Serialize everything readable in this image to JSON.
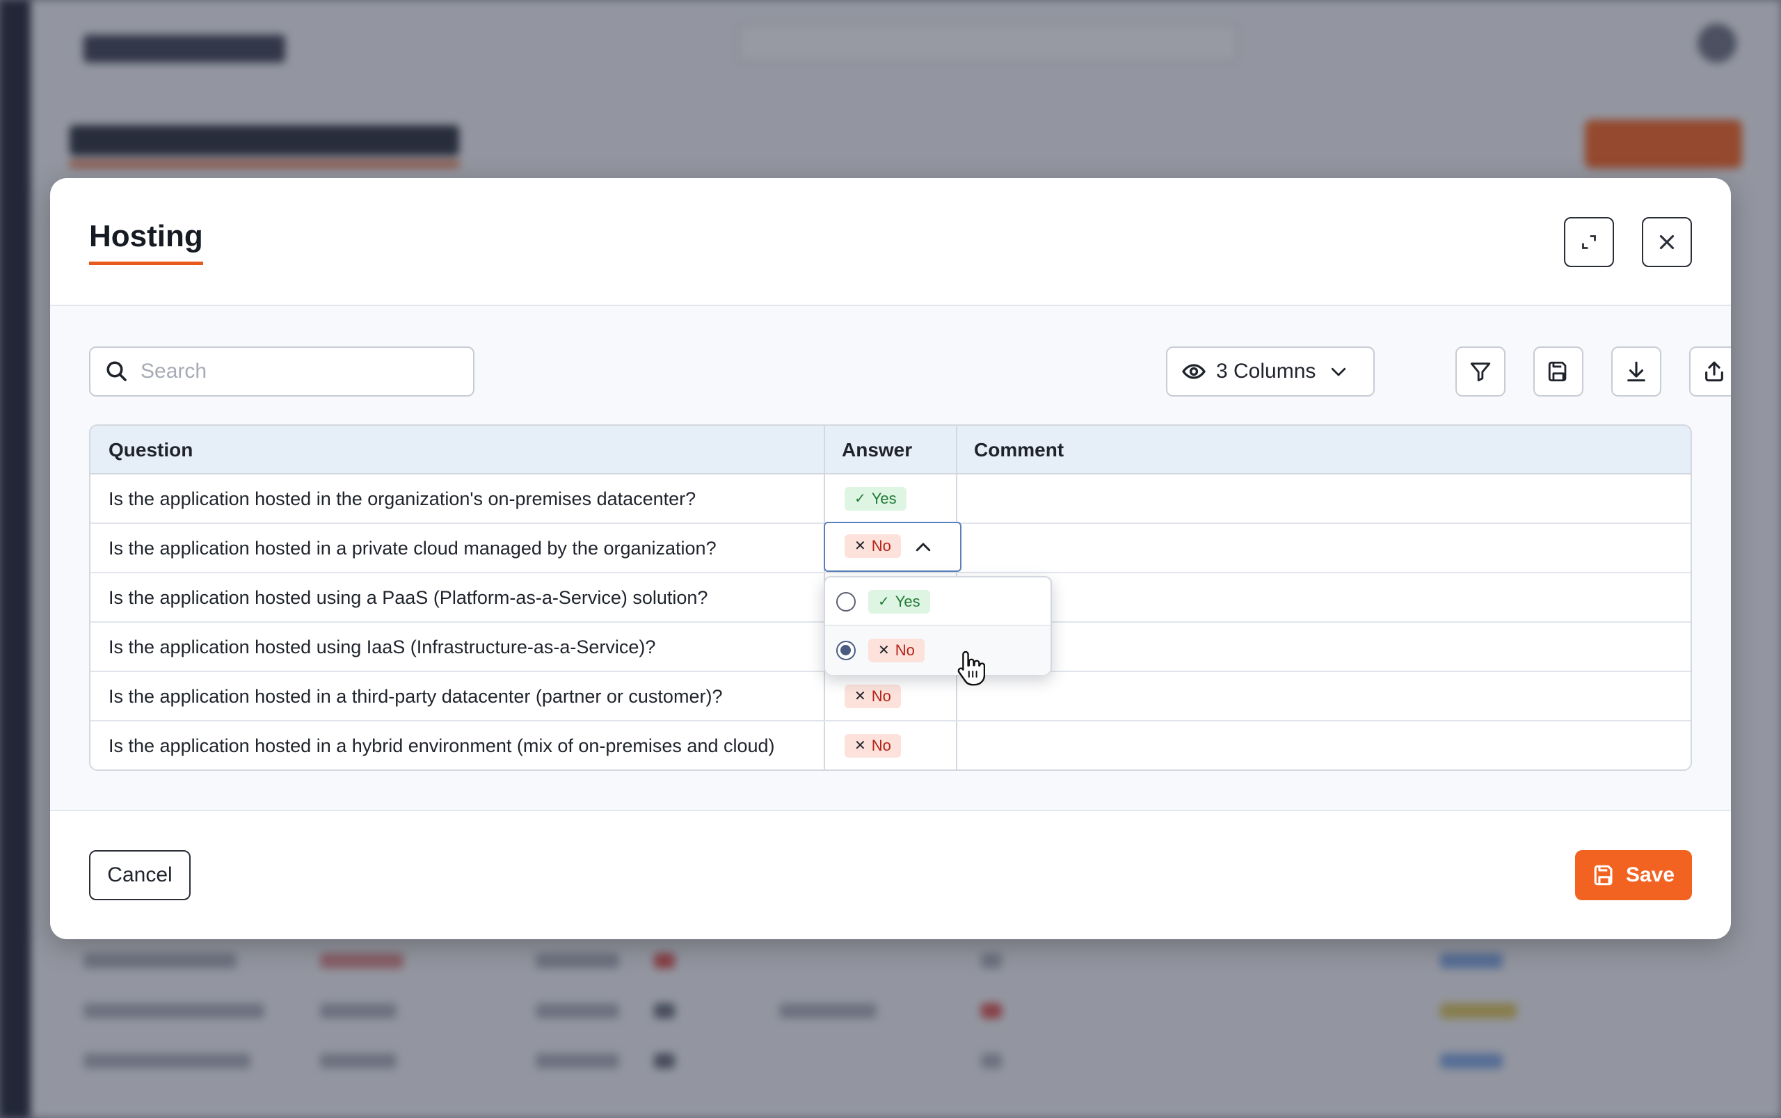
{
  "modal": {
    "title": "Hosting"
  },
  "toolbar": {
    "search_placeholder": "Search",
    "columns_label": "3 Columns"
  },
  "table": {
    "headers": [
      "Question",
      "Answer",
      "Comment"
    ],
    "rows": [
      {
        "question": "Is the application hosted in the organization's on-premises datacenter?",
        "answer": "Yes",
        "comment": ""
      },
      {
        "question": "Is the application hosted in a private cloud managed by the organization?",
        "answer": "No",
        "comment": ""
      },
      {
        "question": "Is the application hosted using a PaaS (Platform-as-a-Service) solution?",
        "answer": "",
        "comment": ""
      },
      {
        "question": "Is the application hosted using IaaS (Infrastructure-as-a-Service)?",
        "answer": "",
        "comment": ""
      },
      {
        "question": "Is the application hosted in a third-party datacenter (partner or customer)?",
        "answer": "No",
        "comment": ""
      },
      {
        "question": "Is the application hosted in a hybrid environment (mix of on-premises and cloud)",
        "answer": "No",
        "comment": ""
      }
    ]
  },
  "dropdown": {
    "options": [
      {
        "label": "Yes",
        "selected": false
      },
      {
        "label": "No",
        "selected": true
      }
    ]
  },
  "footer": {
    "cancel_label": "Cancel",
    "save_label": "Save"
  },
  "colors": {
    "accent": "#f26322",
    "yes_bg": "#dff5e3",
    "yes_text": "#1f7a34",
    "no_bg": "#fde2dc",
    "no_text": "#b42318",
    "header_bg": "#e6eef8"
  }
}
